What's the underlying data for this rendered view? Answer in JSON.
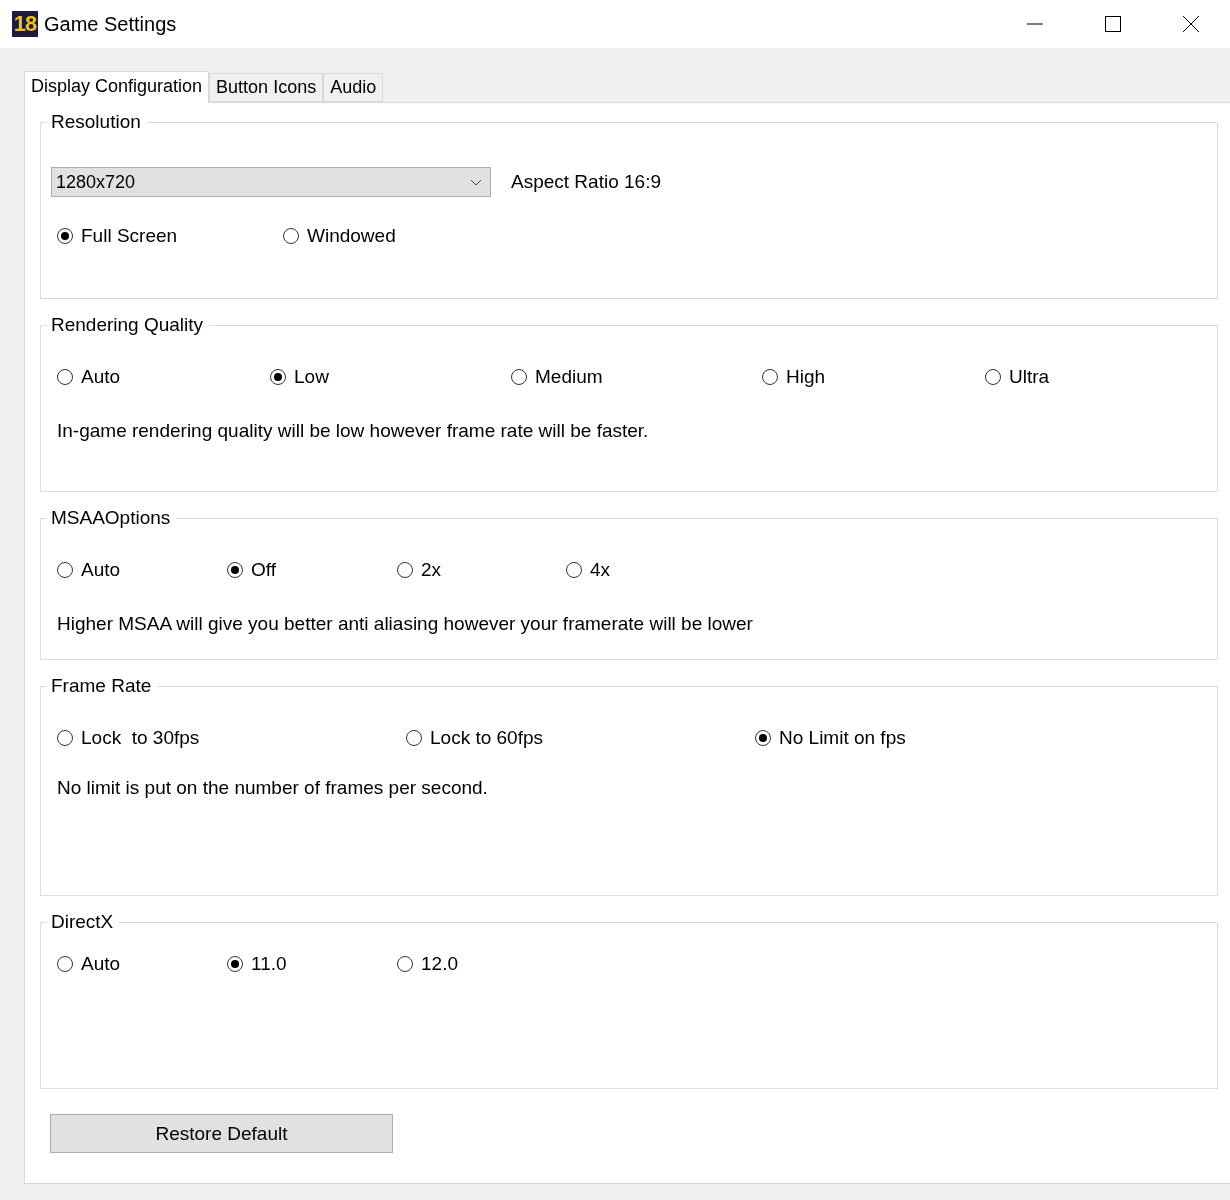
{
  "window": {
    "logo": "18",
    "title": "Game Settings"
  },
  "tabs": [
    {
      "label": "Display Configuration",
      "selected": true
    },
    {
      "label": "Button Icons",
      "selected": false
    },
    {
      "label": "Audio",
      "selected": false
    }
  ],
  "groups": [
    {
      "kind": "resolution",
      "title": "Resolution",
      "dropdown": {
        "value": "1280x720"
      },
      "aspect": "Aspect Ratio 16:9",
      "options": [
        {
          "label": "Full Screen",
          "selected": true
        },
        {
          "label": "Windowed",
          "selected": false
        }
      ]
    },
    {
      "kind": "options",
      "title": "Rendering Quality",
      "options": [
        {
          "label": "Auto",
          "selected": false
        },
        {
          "label": "Low",
          "selected": true
        },
        {
          "label": "Medium",
          "selected": false
        },
        {
          "label": "High",
          "selected": false
        },
        {
          "label": "Ultra",
          "selected": false
        }
      ],
      "description": "In-game rendering quality will be low however frame rate will be faster."
    },
    {
      "kind": "options",
      "title": "MSAAOptions",
      "options": [
        {
          "label": "Auto",
          "selected": false
        },
        {
          "label": "Off",
          "selected": true
        },
        {
          "label": "2x",
          "selected": false
        },
        {
          "label": "4x",
          "selected": false
        }
      ],
      "description": "Higher MSAA will give you better anti aliasing however your framerate will be lower"
    },
    {
      "kind": "options",
      "title": "Frame Rate",
      "options": [
        {
          "label": "Lock  to 30fps",
          "selected": false
        },
        {
          "label": "Lock to 60fps",
          "selected": false
        },
        {
          "label": "No Limit on fps",
          "selected": true
        }
      ],
      "description": "No limit is put on the number of frames per second."
    },
    {
      "kind": "options",
      "title": "DirectX",
      "options": [
        {
          "label": "Auto",
          "selected": false
        },
        {
          "label": "11.0",
          "selected": true
        },
        {
          "label": "12.0",
          "selected": false
        }
      ]
    }
  ],
  "restore_button": "Restore Default"
}
